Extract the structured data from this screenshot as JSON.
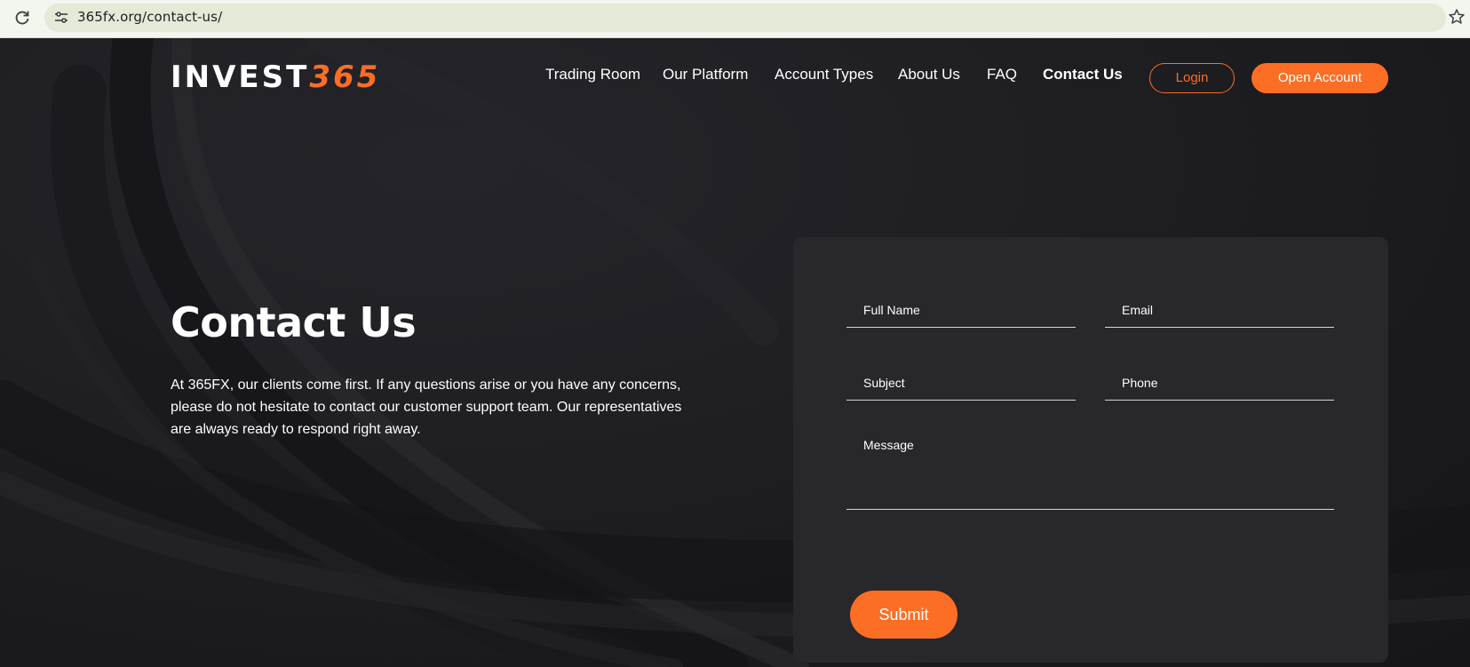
{
  "browser": {
    "url": "365fx.org/contact-us/",
    "reload_icon": "reload-icon",
    "site_info_icon": "site-info-icon",
    "bookmark_icon": "star-icon"
  },
  "header": {
    "logo_main": "INVEST",
    "logo_number": "365",
    "nav": [
      {
        "label": "Trading Room"
      },
      {
        "label": "Our Platform"
      },
      {
        "label": "Account Types"
      },
      {
        "label": "About Us"
      },
      {
        "label": "FAQ"
      },
      {
        "label": "Contact Us",
        "active": true
      }
    ],
    "login_label": "Login",
    "open_account_label": "Open Account"
  },
  "hero": {
    "title": "Contact Us",
    "text": "At 365FX, our clients come first. If any questions arise or you have any concerns, please do not hesitate to contact our customer support team. Our representatives are always ready to respond right away."
  },
  "form": {
    "full_name_placeholder": "Full Name",
    "email_placeholder": "Email",
    "subject_placeholder": "Subject",
    "phone_placeholder": "Phone",
    "message_placeholder": "Message",
    "submit_label": "Submit"
  },
  "colors": {
    "accent": "#fb6e24",
    "background": "#1f1f23",
    "card": "#27272c",
    "text": "#ffffff"
  }
}
